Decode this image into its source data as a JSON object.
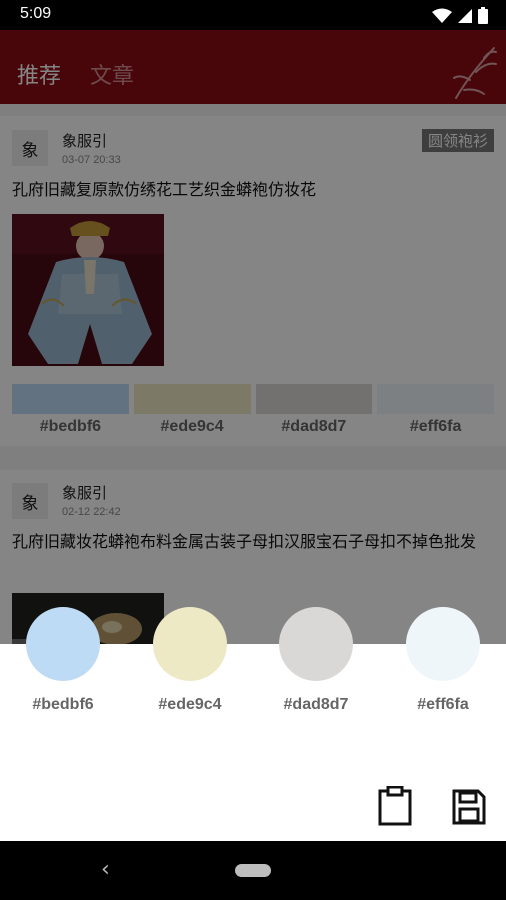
{
  "status_bar": {
    "time": "5:09"
  },
  "tabs": [
    {
      "label": "推荐"
    },
    {
      "label": "文章"
    }
  ],
  "cards": [
    {
      "avatar": "象",
      "author": "象服引",
      "date": "03-07 20:33",
      "tag": "圆领袍衫",
      "title": "孔府旧藏复原款仿绣花工艺织金蟒袍仿妆花",
      "swatches": [
        "#bedbf6",
        "#ede9c4",
        "#dad8d7",
        "#eff6fa"
      ]
    },
    {
      "avatar": "象",
      "author": "象服引",
      "date": "02-12 22:42",
      "title": "孔府旧藏妆花蟒袍布料金属古装子母扣汉服宝石子母扣不掉色批发"
    }
  ],
  "palette_sheet": {
    "colors": [
      "#bedbf6",
      "#ede9c4",
      "#dad8d7",
      "#eff6fa"
    ],
    "labels": [
      "#bedbf6",
      "#ede9c4",
      "#dad8d7",
      "#eff6fa"
    ]
  },
  "icons": {
    "clipboard": "clipboard-icon",
    "save": "save-icon",
    "back": "back-icon",
    "home": "home-pill"
  },
  "theme": {
    "appbar": "#8c0d14",
    "scrim": "rgba(0,0,0,0.48)"
  }
}
